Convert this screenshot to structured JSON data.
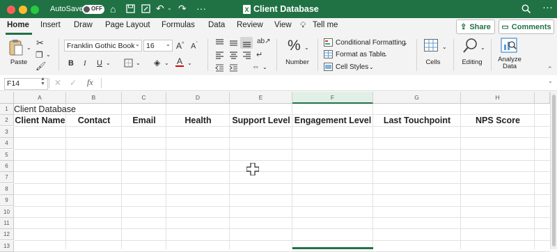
{
  "window": {
    "autosave_label": "AutoSave",
    "autosave_state": "OFF",
    "title": "Client Database"
  },
  "tabs": [
    "Home",
    "Insert",
    "Draw",
    "Page Layout",
    "Formulas",
    "Data",
    "Review",
    "View"
  ],
  "tell_me": "Tell me",
  "share_label": "Share",
  "comments_label": "Comments",
  "ribbon": {
    "paste_label": "Paste",
    "font_name": "Franklin Gothic Book",
    "font_size": "16",
    "number_label": "Number",
    "conditional_formatting": "Conditional Formatting",
    "format_as_table": "Format as Table",
    "cell_styles": "Cell Styles",
    "cells_label": "Cells",
    "editing_label": "Editing",
    "analyze_line1": "Analyze",
    "analyze_line2": "Data"
  },
  "formula_bar": {
    "name_box": "F14",
    "fx": "fx"
  },
  "columns": [
    "A",
    "B",
    "C",
    "D",
    "E",
    "F",
    "G",
    "H"
  ],
  "selected_column": "F",
  "rows": [
    "1",
    "2",
    "3",
    "4",
    "5",
    "6",
    "7",
    "8",
    "9",
    "10",
    "11",
    "12",
    "13"
  ],
  "sheet": {
    "a1": "Client Database",
    "headers": [
      "Client Name",
      "Contact",
      "Email",
      "Health",
      "Support Level",
      "Engagement Level",
      "Last Touchpoint",
      "NPS Score"
    ]
  },
  "colors": {
    "accent": "#207245",
    "titlebar": "#207245"
  }
}
